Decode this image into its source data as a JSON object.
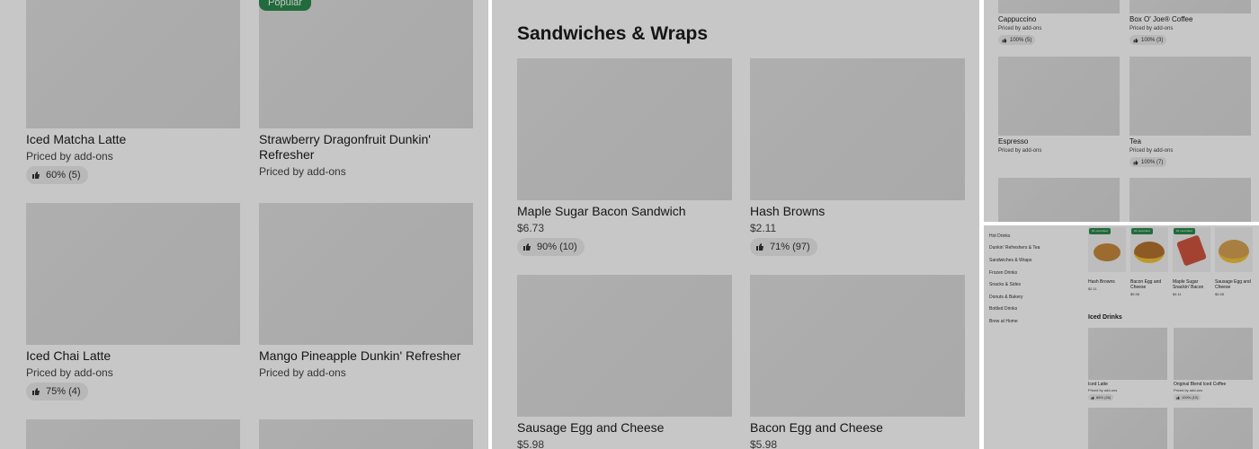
{
  "panel1": {
    "items": [
      {
        "title": "Iced Matcha Latte",
        "sub": "Priced by add-ons",
        "rating": "60% (5)"
      },
      {
        "title": "Strawberry Dragonfruit Dunkin' Refresher",
        "sub": "Priced by add-ons",
        "badge": "Popular"
      },
      {
        "title": "Iced Chai Latte",
        "sub": "Priced by add-ons",
        "rating": "75% (4)"
      },
      {
        "title": "Mango Pineapple Dunkin' Refresher",
        "sub": "Priced by add-ons"
      }
    ]
  },
  "panel2": {
    "section_title": "Sandwiches & Wraps",
    "items": [
      {
        "title": "Maple Sugar Bacon Sandwich",
        "price": "$6.73",
        "rating": "90% (10)"
      },
      {
        "title": "Hash Browns",
        "price": "$2.11",
        "rating": "71% (97)"
      },
      {
        "title": "Sausage Egg and Cheese",
        "price": "$5.98"
      },
      {
        "title": "Bacon Egg and Cheese",
        "price": "$5.98"
      }
    ]
  },
  "panel3": {
    "items": [
      {
        "title": "Cappuccino",
        "sub": "Priced by add-ons",
        "rating": "100% (5)"
      },
      {
        "title": "Box O' Joe® Coffee",
        "sub": "Priced by add-ons",
        "rating": "100% (3)"
      },
      {
        "title": "Espresso",
        "sub": "Priced by add-ons"
      },
      {
        "title": "Tea",
        "sub": "Priced by add-ons",
        "rating": "100% (7)"
      }
    ]
  },
  "panel4": {
    "nav": [
      "Hot Drinks",
      "Dunkin' Refreshers & Tea",
      "Sandwiches & Wraps",
      "Frozen Drinks",
      "Snacks & Sides",
      "Donuts & Bakery",
      "Bottled Drinks",
      "Brew at Home"
    ],
    "featured": [
      {
        "title": "Hash Browns",
        "price": "$2.11",
        "badge": "#1 most liked"
      },
      {
        "title": "Bacon Egg and Cheese",
        "price": "$5.98",
        "badge": "#1 most liked"
      },
      {
        "title": "Maple Sugar Snackin' Bacon",
        "price": "$4.11",
        "badge": "#1 most liked"
      },
      {
        "title": "Sausage Egg and Cheese",
        "price": "$5.98"
      }
    ],
    "section_title": "Iced Drinks",
    "items": [
      {
        "title": "Iced Latte",
        "sub": "Priced by add-ons",
        "rating": "88% (26)"
      },
      {
        "title": "Original Blend Iced Coffee",
        "sub": "Priced by add-ons",
        "rating": "100% (10)"
      }
    ]
  }
}
